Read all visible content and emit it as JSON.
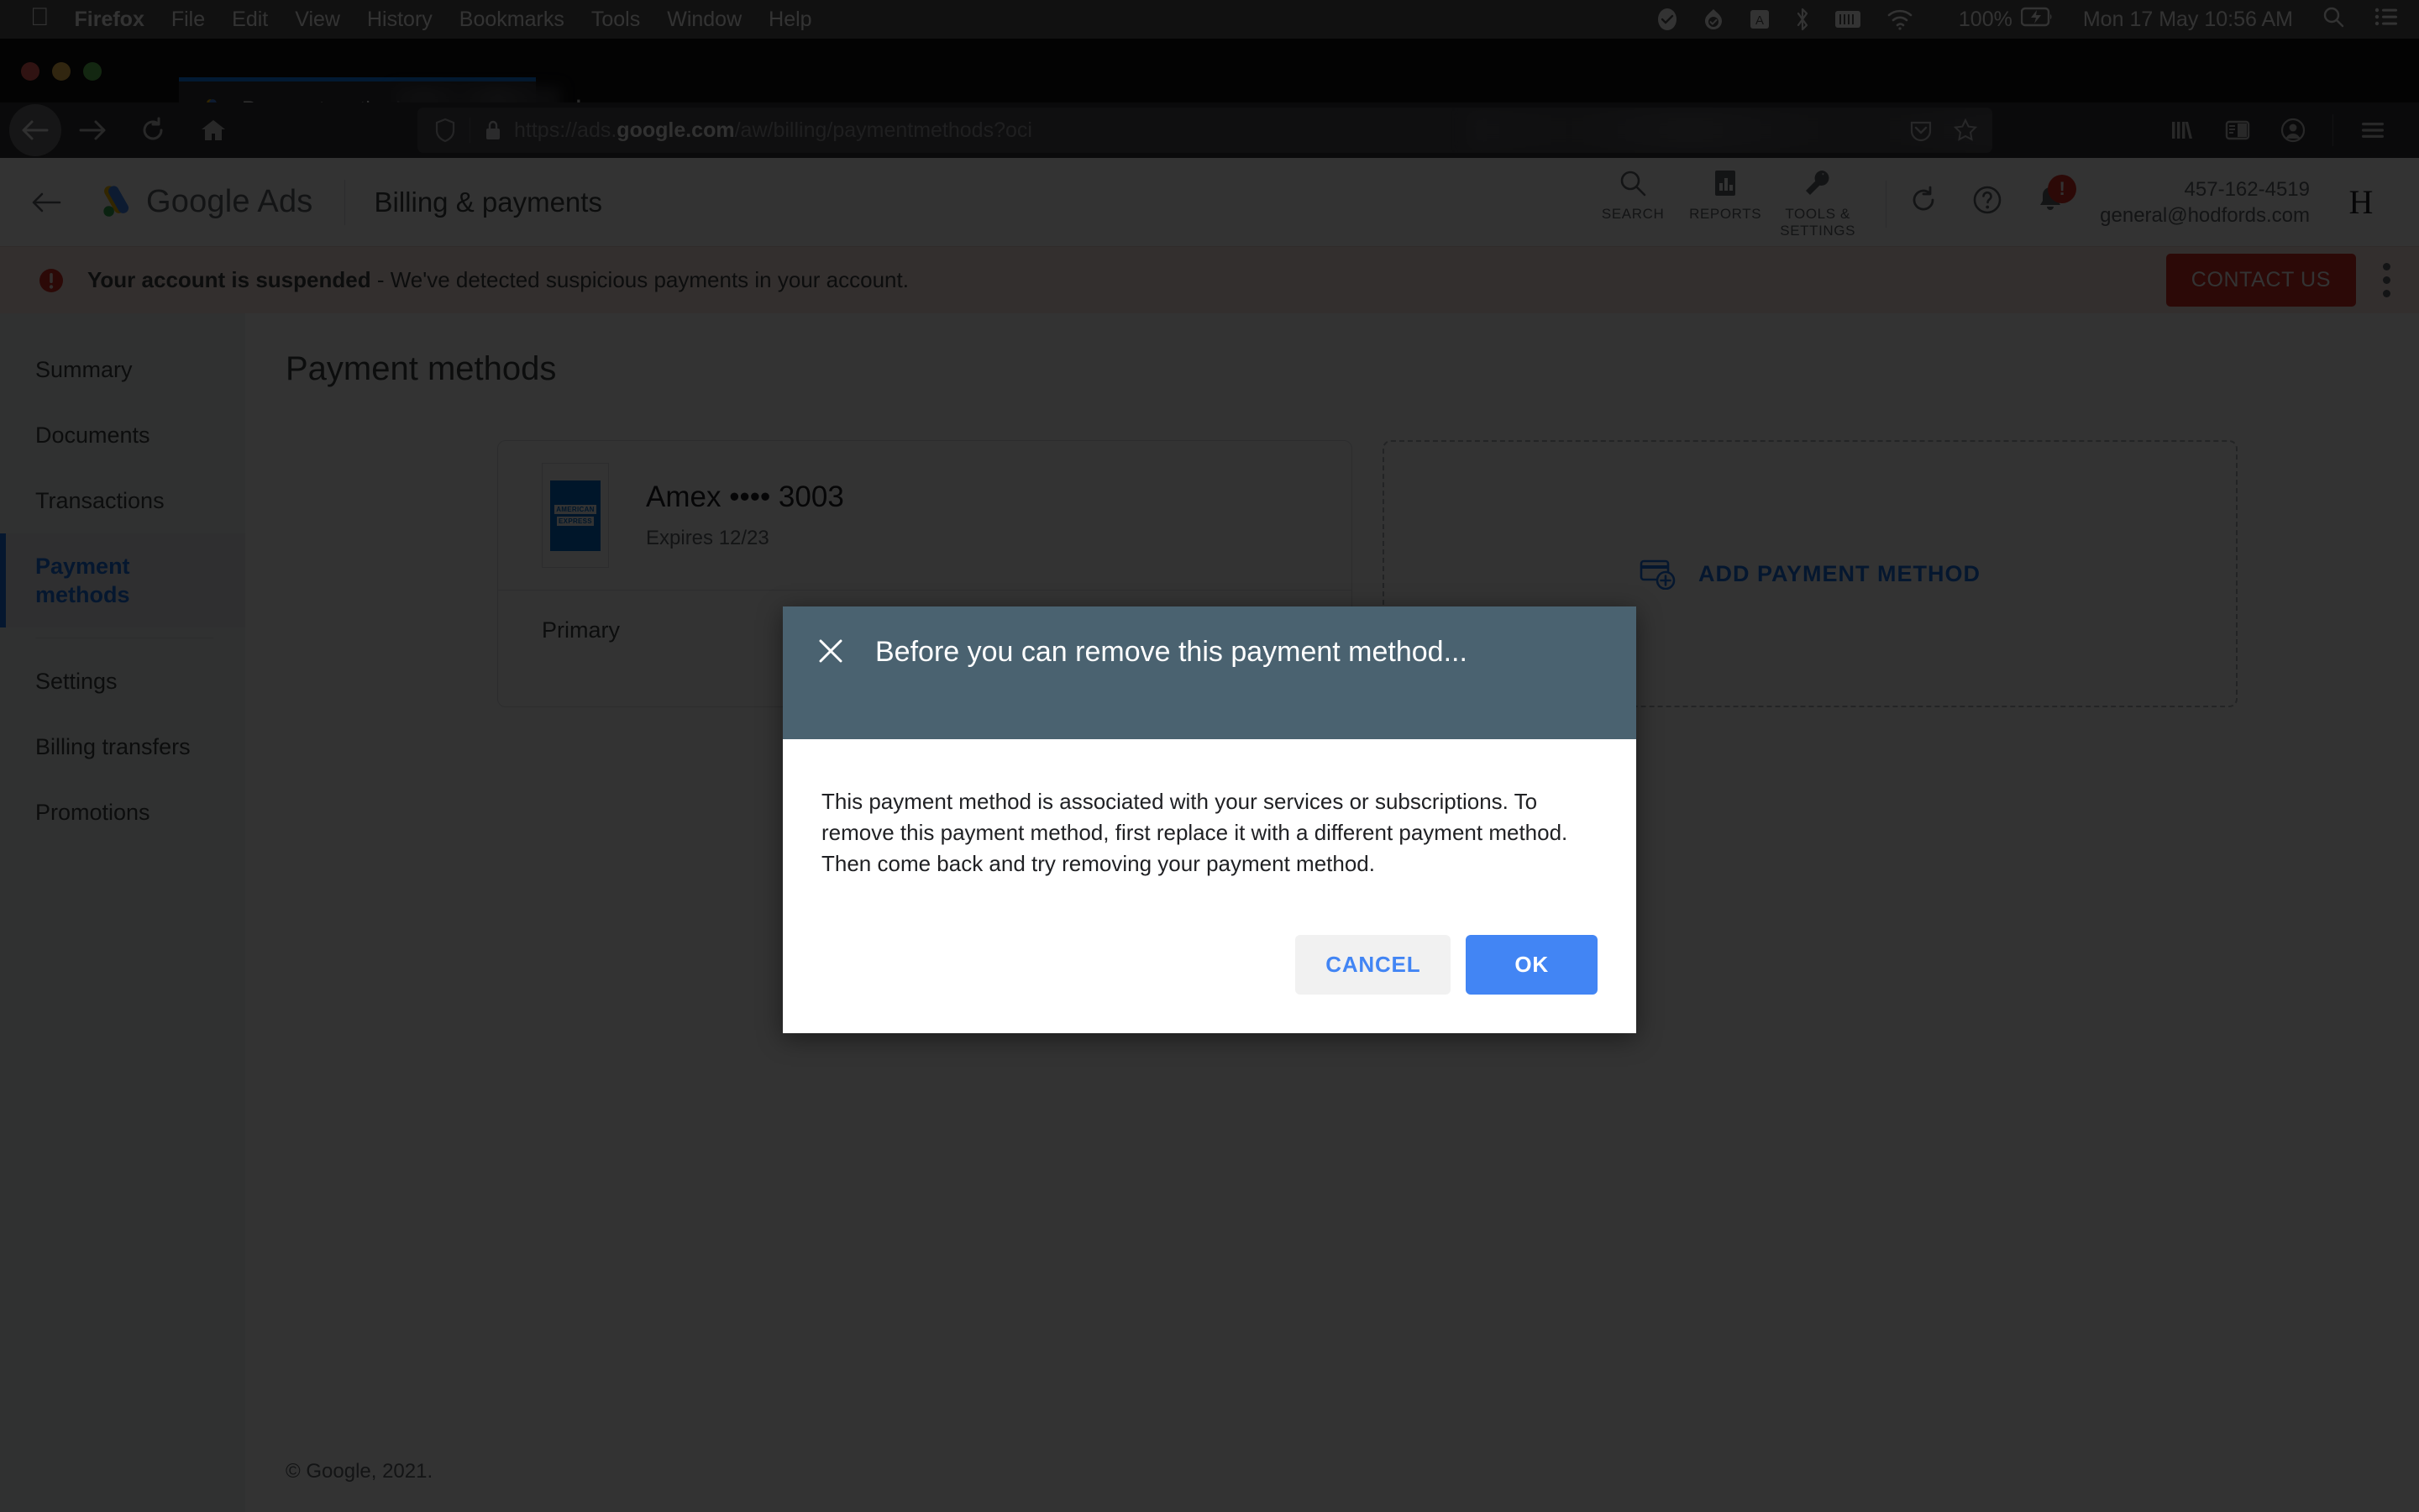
{
  "macos": {
    "apple_icon": "apple-icon",
    "app_name": "Firefox",
    "menus": [
      "File",
      "Edit",
      "View",
      "History",
      "Bookmarks",
      "Tools",
      "Window",
      "Help"
    ],
    "status_icons": [
      "checkmark-shield-icon",
      "cloud-check-icon",
      "keyboard-input-icon",
      "bluetooth-icon",
      "battery-bar-icon",
      "wifi-icon"
    ],
    "battery_percent": "100%",
    "battery_icon": "battery-charging-icon",
    "clock": "Mon 17 May  10:56 AM",
    "search_icon": "spotlight-search-icon",
    "control_center_icon": "control-center-icon"
  },
  "browser": {
    "tab": {
      "favicon": "google-ads-favicon",
      "title": "Payment methods",
      "blurred_suffix": true
    },
    "new_tab_label": "+",
    "nav": {
      "back_icon": "back-arrow-icon",
      "forward_icon": "forward-arrow-icon",
      "reload_icon": "reload-icon",
      "home_icon": "home-icon"
    },
    "url": {
      "prefix": "https://ads.",
      "domain": "google.com",
      "path": "/aw/billing/paymentmethods?oci",
      "shield_icon": "tracking-protection-shield-icon",
      "lock_icon": "padlock-icon",
      "pocket_icon": "pocket-icon",
      "bookmark_icon": "star-bookmark-icon"
    },
    "toolbar_right": {
      "library_icon": "library-icon",
      "sidebar_icon": "sidebar-icon",
      "account_icon": "account-circle-icon",
      "menu_icon": "hamburger-menu-icon"
    }
  },
  "ads": {
    "header": {
      "back_icon": "back-arrow-icon",
      "logo_icon": "google-ads-logo-icon",
      "logo_text": "Google Ads",
      "section_title": "Billing & payments",
      "tools": [
        {
          "icon": "search-icon",
          "label": "SEARCH"
        },
        {
          "icon": "reports-bar-chart-icon",
          "label": "REPORTS"
        },
        {
          "icon": "wrench-tools-icon",
          "label": "TOOLS &\nSETTINGS"
        }
      ],
      "refresh_icon": "refresh-icon",
      "help_icon": "help-circle-icon",
      "notification_icon": "bell-icon",
      "notification_badge": "!",
      "account_id": "457-162-4519",
      "account_email": "general@hodfords.com",
      "avatar_letter": "H"
    },
    "banner": {
      "error_icon": "error-exclamation-icon",
      "headline": "Your account is suspended",
      "message": " - We've detected suspicious payments in your account.",
      "contact_label": "CONTACT US",
      "kebab_icon": "more-vertical-icon",
      "accent_color": "#d93025"
    },
    "sidebar": [
      {
        "label": "Summary",
        "active": false
      },
      {
        "label": "Documents",
        "active": false
      },
      {
        "label": "Transactions",
        "active": false
      },
      {
        "label": "Payment methods",
        "active": true
      },
      {
        "label": "Settings",
        "active": false
      },
      {
        "label": "Billing transfers",
        "active": false
      },
      {
        "label": "Promotions",
        "active": false
      }
    ],
    "page_title": "Payment methods",
    "payment_card": {
      "brand_logo": "american-express-logo-icon",
      "brand_logo_line1": "AMERICAN",
      "brand_logo_line2": "EXPRESS",
      "title": "Amex •••• 3003",
      "expires": "Expires 12/23",
      "status": "Primary"
    },
    "add_card": {
      "icon": "add-card-icon",
      "label": "ADD PAYMENT METHOD",
      "accent_color": "#1a73e8"
    },
    "footer": "© Google, 2021."
  },
  "dialog": {
    "close_icon": "close-x-icon",
    "title": "Before you can remove this payment method...",
    "body": "This payment method is associated with your services or subscriptions. To remove this payment method, first replace it with a different payment method. Then come back and try removing your payment method.",
    "cancel_label": "CANCEL",
    "ok_label": "OK",
    "header_color": "#4a6270",
    "primary_color": "#4285f4"
  }
}
